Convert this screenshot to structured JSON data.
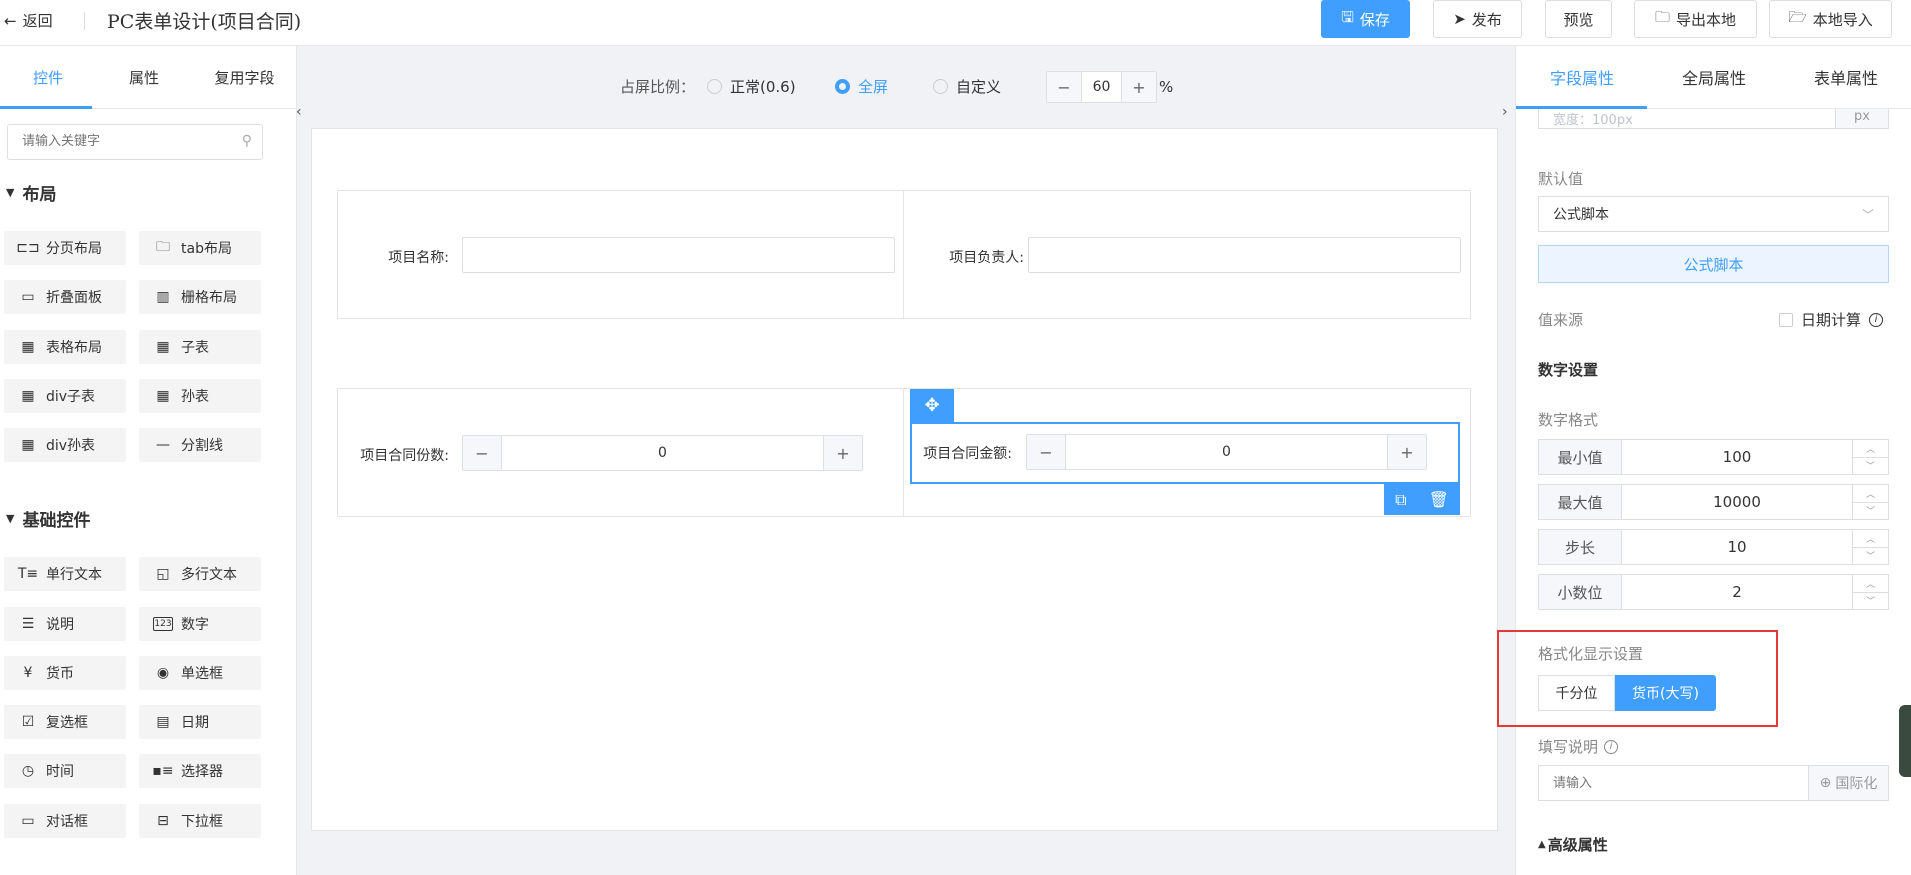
{
  "header": {
    "back_label": "返回",
    "title": "PC表单设计(项目合同)",
    "buttons": {
      "save": "保存",
      "publish": "发布",
      "preview": "预览",
      "export": "导出本地",
      "import": "本地导入"
    }
  },
  "left_panel": {
    "tabs": [
      "控件",
      "属性",
      "复用字段"
    ],
    "active_tab": "控件",
    "search_placeholder": "请输入关键字",
    "layout_section": "布局",
    "layout_items": [
      "分页布局",
      "tab布局",
      "折叠面板",
      "栅格布局",
      "表格布局",
      "子表",
      "div子表",
      "孙表",
      "div孙表",
      "分割线"
    ],
    "basic_section": "基础控件",
    "basic_items": [
      "单行文本",
      "多行文本",
      "说明",
      "数字",
      "货币",
      "单选框",
      "复选框",
      "日期",
      "时间",
      "选择器",
      "对话框",
      "下拉框"
    ]
  },
  "toolbar": {
    "ratio_label": "占屏比例：",
    "options": [
      "正常(0.6)",
      "全屏",
      "自定义"
    ],
    "selected": "全屏",
    "percent_value": "60",
    "percent_unit": "%"
  },
  "form": {
    "fields": {
      "project_name": "项目名称:",
      "project_owner": "项目负责人:",
      "contract_count": "项目合同份数:",
      "contract_count_value": "0",
      "contract_amount": "项目合同金额:",
      "contract_amount_value": "0"
    }
  },
  "right_panel": {
    "tabs": [
      "字段属性",
      "全局属性",
      "表单属性"
    ],
    "active_tab": "字段属性",
    "width_placeholder": "宽度：100px",
    "width_unit": "px",
    "default_value_label": "默认值",
    "default_value_select": "公式脚本",
    "formula_button": "公式脚本",
    "value_source_label": "值来源",
    "date_calc_label": "日期计算",
    "number_settings_title": "数字设置",
    "number_format_label": "数字格式",
    "number_rows": [
      {
        "label": "最小值",
        "value": "100"
      },
      {
        "label": "最大值",
        "value": "10000"
      },
      {
        "label": "步长",
        "value": "10"
      },
      {
        "label": "小数位",
        "value": "2"
      }
    ],
    "format_display_label": "格式化显示设置",
    "format_options": [
      "千分位",
      "货币(大写)"
    ],
    "format_selected": "货币(大写)",
    "fill_hint_label": "填写说明",
    "fill_hint_placeholder": "请输入",
    "i18n_label": "国际化",
    "advanced_label": "高级属性"
  },
  "colors": {
    "accent": "#409eff",
    "highlight_box": "#e53935"
  }
}
